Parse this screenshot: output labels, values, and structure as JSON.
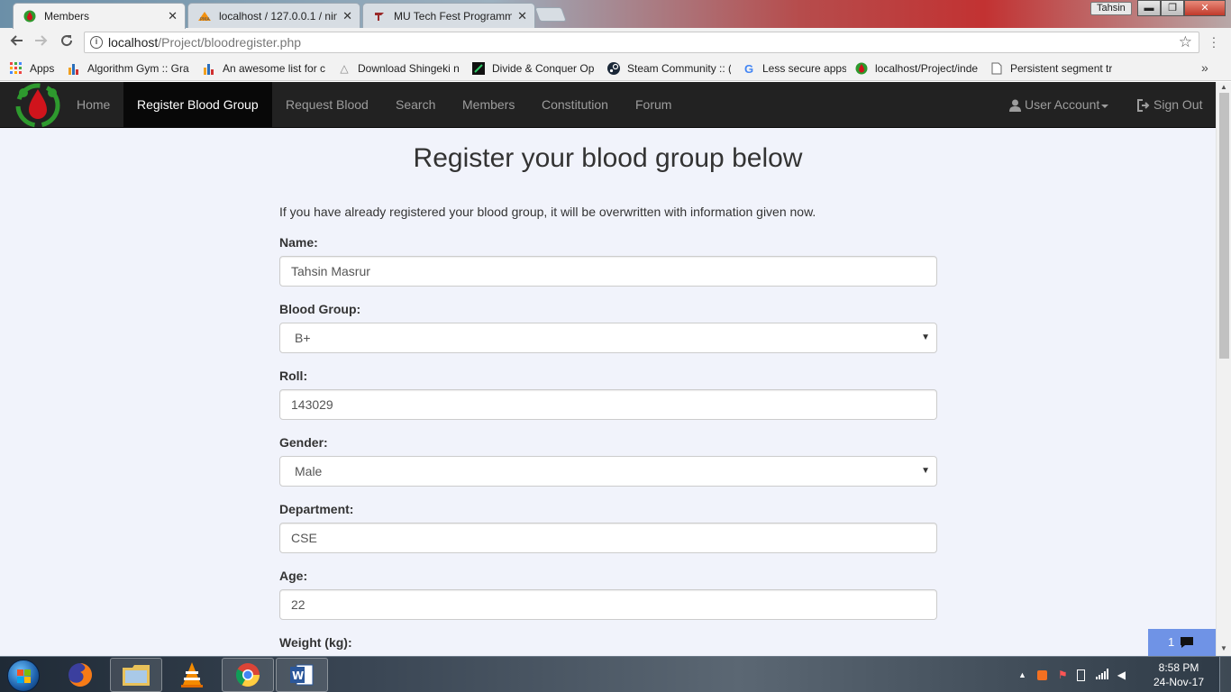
{
  "browser": {
    "tabs": [
      {
        "title": "Members",
        "active": true,
        "close": "✕"
      },
      {
        "title": "localhost / 127.0.0.1 / nin",
        "active": false,
        "close": "✕"
      },
      {
        "title": "MU Tech Fest Programm",
        "active": false,
        "close": "✕"
      }
    ],
    "profile_name": "Tahsin",
    "window_controls": {
      "minimize": "▬",
      "maximize": "❐",
      "close": "✕"
    },
    "url_host": "localhost",
    "url_path": "/Project/bloodregister.php",
    "bookmarks": [
      {
        "label": "Apps",
        "icon": "apps-grid-icon"
      },
      {
        "label": "Algorithm Gym :: Gra",
        "icon": "bar-chart-icon"
      },
      {
        "label": "An awesome list for c",
        "icon": "bar-chart-icon"
      },
      {
        "label": "Download Shingeki n",
        "icon": "anime-icon"
      },
      {
        "label": "Divide & Conquer Op",
        "icon": "hackerrank-icon"
      },
      {
        "label": "Steam Community :: (",
        "icon": "steam-icon"
      },
      {
        "label": "Less secure apps",
        "icon": "google-icon"
      },
      {
        "label": "localhost/Project/inde",
        "icon": "blood-drop-icon"
      },
      {
        "label": "Persistent segment tr",
        "icon": "page-icon"
      }
    ]
  },
  "site": {
    "nav": {
      "items": [
        "Home",
        "Register Blood Group",
        "Request Blood",
        "Search",
        "Members",
        "Constitution",
        "Forum"
      ],
      "active_index": 1,
      "user_account": "User Account",
      "sign_out": "Sign Out"
    },
    "page_title": "Register your blood group below",
    "intro": "If you have already registered your blood group, it will be overwritten with information given now.",
    "form": {
      "name_label": "Name:",
      "name_value": "Tahsin Masrur",
      "blood_group_label": "Blood Group:",
      "blood_group_value": "B+",
      "roll_label": "Roll:",
      "roll_value": "143029",
      "gender_label": "Gender:",
      "gender_value": "Male",
      "department_label": "Department:",
      "department_value": "CSE",
      "age_label": "Age:",
      "age_value": "22",
      "weight_label": "Weight (kg):"
    },
    "chat_widget_count": "1"
  },
  "taskbar": {
    "time": "8:58 PM",
    "date": "24-Nov-17"
  },
  "colors": {
    "navbar_bg": "#222222",
    "navbar_active_bg": "#080808",
    "page_bg": "#f1f3fb",
    "chat_widget": "#6f93e6",
    "blood_red": "#d0141c",
    "logo_green": "#2e9a2e"
  }
}
